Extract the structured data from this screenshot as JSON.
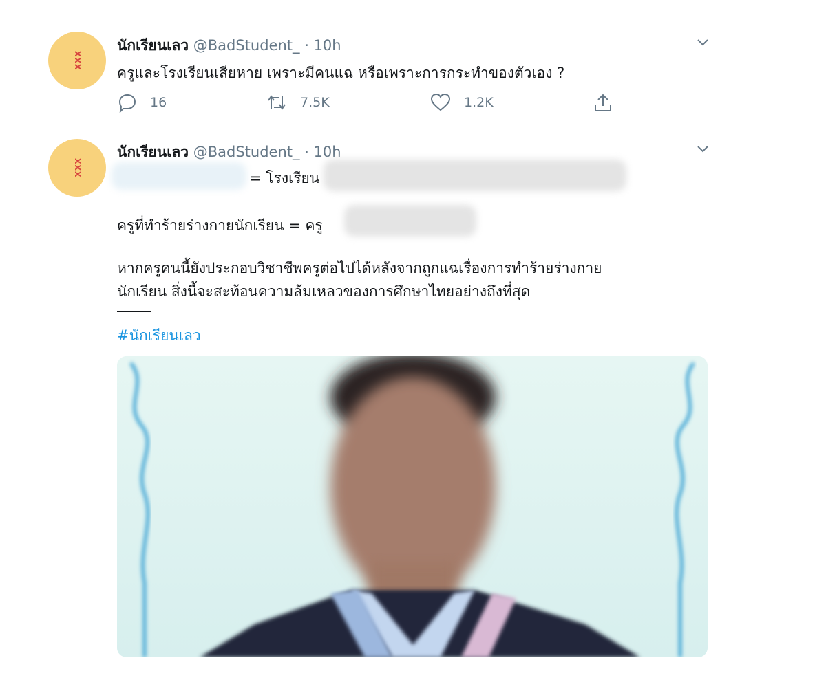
{
  "tweets": [
    {
      "avatar_text": "XXX",
      "name": "นักเรียนเลว",
      "handle": "@BadStudent_",
      "separator": "·",
      "time": "10h",
      "text": "ครูและโรงเรียนเสียหาย เพราะมีคนแฉ หรือเพราะการกระทำของตัวเอง ?",
      "replies": "16",
      "retweets": "7.5K",
      "likes": "1.2K"
    },
    {
      "avatar_text": "XXX",
      "name": "นักเรียนเลว",
      "handle": "@BadStudent_",
      "separator": "·",
      "time": "10h",
      "line1": "= โรงเรียน",
      "line2": "ครูที่ทำร้ายร่างกายนักเรียน = ครู",
      "line3": "หากครูคนนี้ยังประกอบวิชาชีพครูต่อไปได้หลังจากถูกแฉเรื่องการทำร้ายร่างกาย",
      "line4": "นักเรียน สิ่งนี้จะสะท้อนความล้มเหลวของการศึกษาไทยอย่างถึงที่สุด",
      "hashtag": "#นักเรียนเลว"
    }
  ],
  "colors": {
    "avatar": "#f8d27c",
    "link": "#1b95e0",
    "muted": "#657786"
  }
}
